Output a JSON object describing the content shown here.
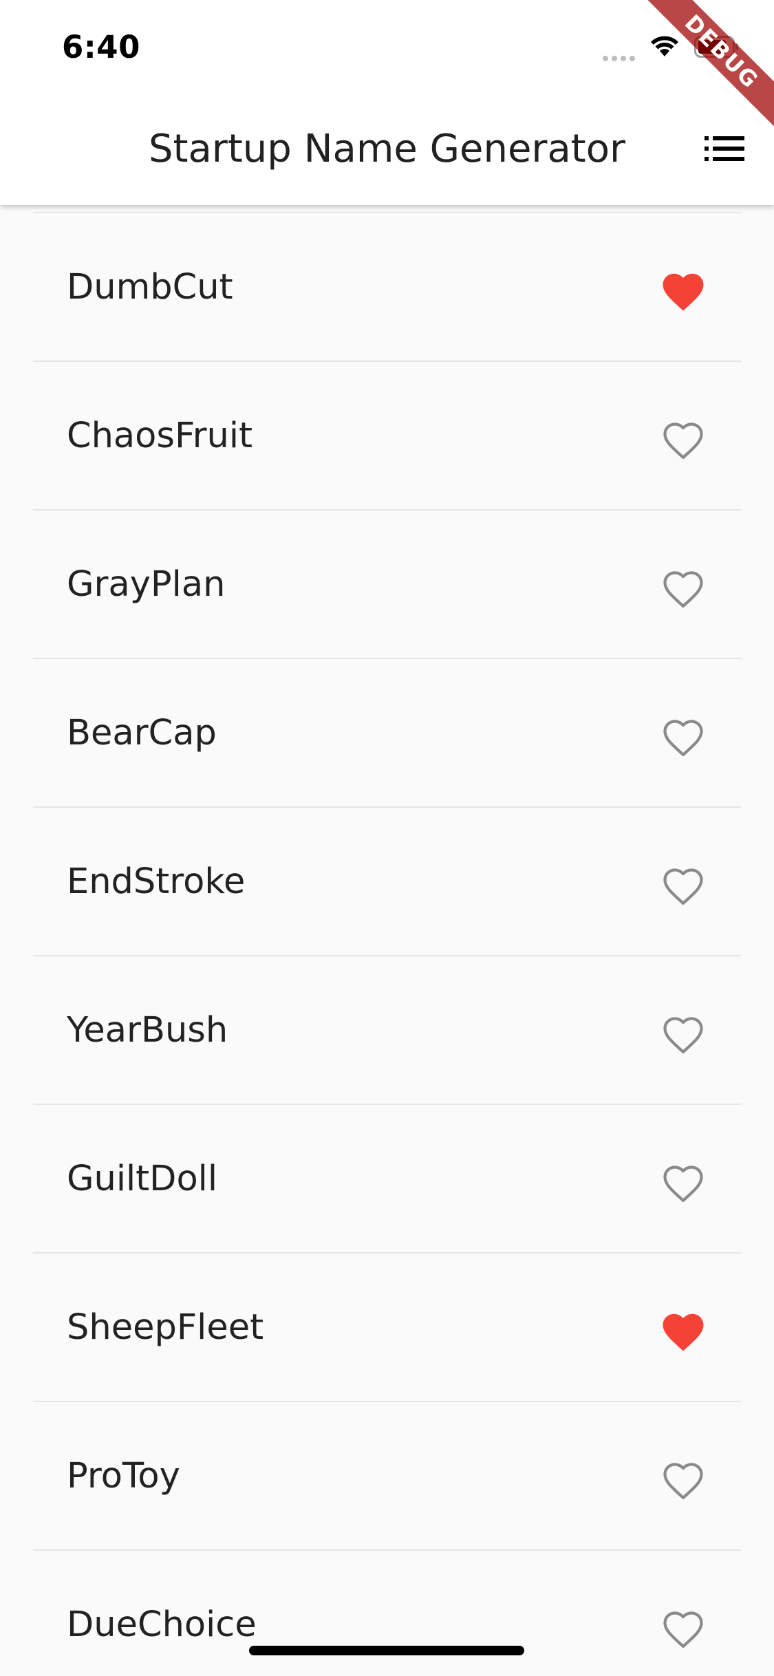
{
  "status_bar": {
    "time": "6:40"
  },
  "app_bar": {
    "title": "Startup Name Generator",
    "action_icon": "list-icon"
  },
  "debug_banner": {
    "text": "DEBUG"
  },
  "colors": {
    "saved_heart": "#f44336",
    "unsaved_heart": "#8a8a8a",
    "app_bar_background": "#ffffff",
    "list_background": "#fafafa",
    "debug_banner": "#a00000"
  },
  "suggestions": [
    {
      "name": "DumbCut",
      "saved": true
    },
    {
      "name": "ChaosFruit",
      "saved": false
    },
    {
      "name": "GrayPlan",
      "saved": false
    },
    {
      "name": "BearCap",
      "saved": false
    },
    {
      "name": "EndStroke",
      "saved": false
    },
    {
      "name": "YearBush",
      "saved": false
    },
    {
      "name": "GuiltDoll",
      "saved": false
    },
    {
      "name": "SheepFleet",
      "saved": true
    },
    {
      "name": "ProToy",
      "saved": false
    },
    {
      "name": "DueChoice",
      "saved": false
    }
  ]
}
